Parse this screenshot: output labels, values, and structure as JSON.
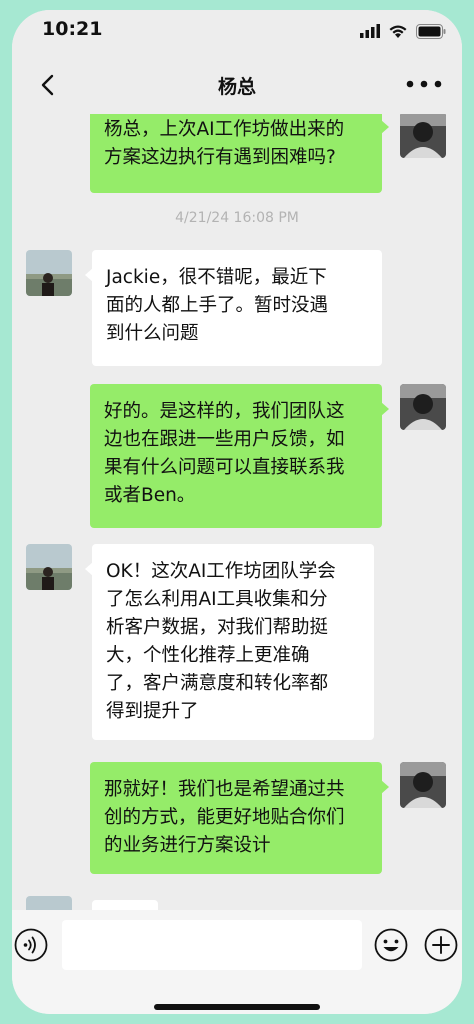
{
  "status_bar": {
    "time": "10:21"
  },
  "nav": {
    "title": "杨总"
  },
  "messages": [
    {
      "from": "me",
      "text": "杨总，上次AI工作坊做出来的\n方案这边执行有遇到困难吗?"
    },
    {
      "from": "other",
      "text": "Jackie，很不错呢，最近下\n面的人都上手了。暂时没遇\n到什么问题"
    },
    {
      "from": "me",
      "text": "好的。是这样的，我们团队这\n边也在跟进一些用户反馈，如\n果有什么问题可以直接联系我\n或者Ben。"
    },
    {
      "from": "other",
      "text": "OK！这次AI工作坊团队学会\n了怎么利用AI工具收集和分\n析客户数据，对我们帮助挺\n大，个性化推荐上更准确\n了，客户满意度和转化率都\n得到提升了"
    },
    {
      "from": "me",
      "text": "那就好！我们也是希望通过共\n创的方式，能更好地贴合你们\n的业务进行方案设计"
    }
  ],
  "timestamp": "4/21/24 16:08 PM",
  "icons": {
    "back": "chevron-left-icon",
    "more": "more-dots-icon",
    "voice": "voice-icon",
    "emoji": "emoji-icon",
    "plus": "plus-icon"
  },
  "colors": {
    "my_bubble": "#95EC69",
    "other_bubble": "#FFFFFF",
    "background": "#EDEDED",
    "frame": "#A6E8D2"
  }
}
